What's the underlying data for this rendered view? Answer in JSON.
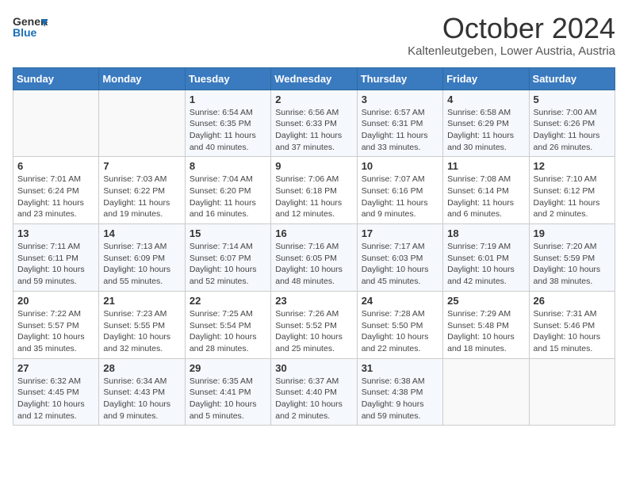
{
  "header": {
    "logo_general": "General",
    "logo_blue": "Blue",
    "month_title": "October 2024",
    "location": "Kaltenleutgeben, Lower Austria, Austria"
  },
  "weekdays": [
    "Sunday",
    "Monday",
    "Tuesday",
    "Wednesday",
    "Thursday",
    "Friday",
    "Saturday"
  ],
  "weeks": [
    [
      {
        "day": "",
        "info": ""
      },
      {
        "day": "",
        "info": ""
      },
      {
        "day": "1",
        "info": "Sunrise: 6:54 AM\nSunset: 6:35 PM\nDaylight: 11 hours and 40 minutes."
      },
      {
        "day": "2",
        "info": "Sunrise: 6:56 AM\nSunset: 6:33 PM\nDaylight: 11 hours and 37 minutes."
      },
      {
        "day": "3",
        "info": "Sunrise: 6:57 AM\nSunset: 6:31 PM\nDaylight: 11 hours and 33 minutes."
      },
      {
        "day": "4",
        "info": "Sunrise: 6:58 AM\nSunset: 6:29 PM\nDaylight: 11 hours and 30 minutes."
      },
      {
        "day": "5",
        "info": "Sunrise: 7:00 AM\nSunset: 6:26 PM\nDaylight: 11 hours and 26 minutes."
      }
    ],
    [
      {
        "day": "6",
        "info": "Sunrise: 7:01 AM\nSunset: 6:24 PM\nDaylight: 11 hours and 23 minutes."
      },
      {
        "day": "7",
        "info": "Sunrise: 7:03 AM\nSunset: 6:22 PM\nDaylight: 11 hours and 19 minutes."
      },
      {
        "day": "8",
        "info": "Sunrise: 7:04 AM\nSunset: 6:20 PM\nDaylight: 11 hours and 16 minutes."
      },
      {
        "day": "9",
        "info": "Sunrise: 7:06 AM\nSunset: 6:18 PM\nDaylight: 11 hours and 12 minutes."
      },
      {
        "day": "10",
        "info": "Sunrise: 7:07 AM\nSunset: 6:16 PM\nDaylight: 11 hours and 9 minutes."
      },
      {
        "day": "11",
        "info": "Sunrise: 7:08 AM\nSunset: 6:14 PM\nDaylight: 11 hours and 6 minutes."
      },
      {
        "day": "12",
        "info": "Sunrise: 7:10 AM\nSunset: 6:12 PM\nDaylight: 11 hours and 2 minutes."
      }
    ],
    [
      {
        "day": "13",
        "info": "Sunrise: 7:11 AM\nSunset: 6:11 PM\nDaylight: 10 hours and 59 minutes."
      },
      {
        "day": "14",
        "info": "Sunrise: 7:13 AM\nSunset: 6:09 PM\nDaylight: 10 hours and 55 minutes."
      },
      {
        "day": "15",
        "info": "Sunrise: 7:14 AM\nSunset: 6:07 PM\nDaylight: 10 hours and 52 minutes."
      },
      {
        "day": "16",
        "info": "Sunrise: 7:16 AM\nSunset: 6:05 PM\nDaylight: 10 hours and 48 minutes."
      },
      {
        "day": "17",
        "info": "Sunrise: 7:17 AM\nSunset: 6:03 PM\nDaylight: 10 hours and 45 minutes."
      },
      {
        "day": "18",
        "info": "Sunrise: 7:19 AM\nSunset: 6:01 PM\nDaylight: 10 hours and 42 minutes."
      },
      {
        "day": "19",
        "info": "Sunrise: 7:20 AM\nSunset: 5:59 PM\nDaylight: 10 hours and 38 minutes."
      }
    ],
    [
      {
        "day": "20",
        "info": "Sunrise: 7:22 AM\nSunset: 5:57 PM\nDaylight: 10 hours and 35 minutes."
      },
      {
        "day": "21",
        "info": "Sunrise: 7:23 AM\nSunset: 5:55 PM\nDaylight: 10 hours and 32 minutes."
      },
      {
        "day": "22",
        "info": "Sunrise: 7:25 AM\nSunset: 5:54 PM\nDaylight: 10 hours and 28 minutes."
      },
      {
        "day": "23",
        "info": "Sunrise: 7:26 AM\nSunset: 5:52 PM\nDaylight: 10 hours and 25 minutes."
      },
      {
        "day": "24",
        "info": "Sunrise: 7:28 AM\nSunset: 5:50 PM\nDaylight: 10 hours and 22 minutes."
      },
      {
        "day": "25",
        "info": "Sunrise: 7:29 AM\nSunset: 5:48 PM\nDaylight: 10 hours and 18 minutes."
      },
      {
        "day": "26",
        "info": "Sunrise: 7:31 AM\nSunset: 5:46 PM\nDaylight: 10 hours and 15 minutes."
      }
    ],
    [
      {
        "day": "27",
        "info": "Sunrise: 6:32 AM\nSunset: 4:45 PM\nDaylight: 10 hours and 12 minutes."
      },
      {
        "day": "28",
        "info": "Sunrise: 6:34 AM\nSunset: 4:43 PM\nDaylight: 10 hours and 9 minutes."
      },
      {
        "day": "29",
        "info": "Sunrise: 6:35 AM\nSunset: 4:41 PM\nDaylight: 10 hours and 5 minutes."
      },
      {
        "day": "30",
        "info": "Sunrise: 6:37 AM\nSunset: 4:40 PM\nDaylight: 10 hours and 2 minutes."
      },
      {
        "day": "31",
        "info": "Sunrise: 6:38 AM\nSunset: 4:38 PM\nDaylight: 9 hours and 59 minutes."
      },
      {
        "day": "",
        "info": ""
      },
      {
        "day": "",
        "info": ""
      }
    ]
  ]
}
